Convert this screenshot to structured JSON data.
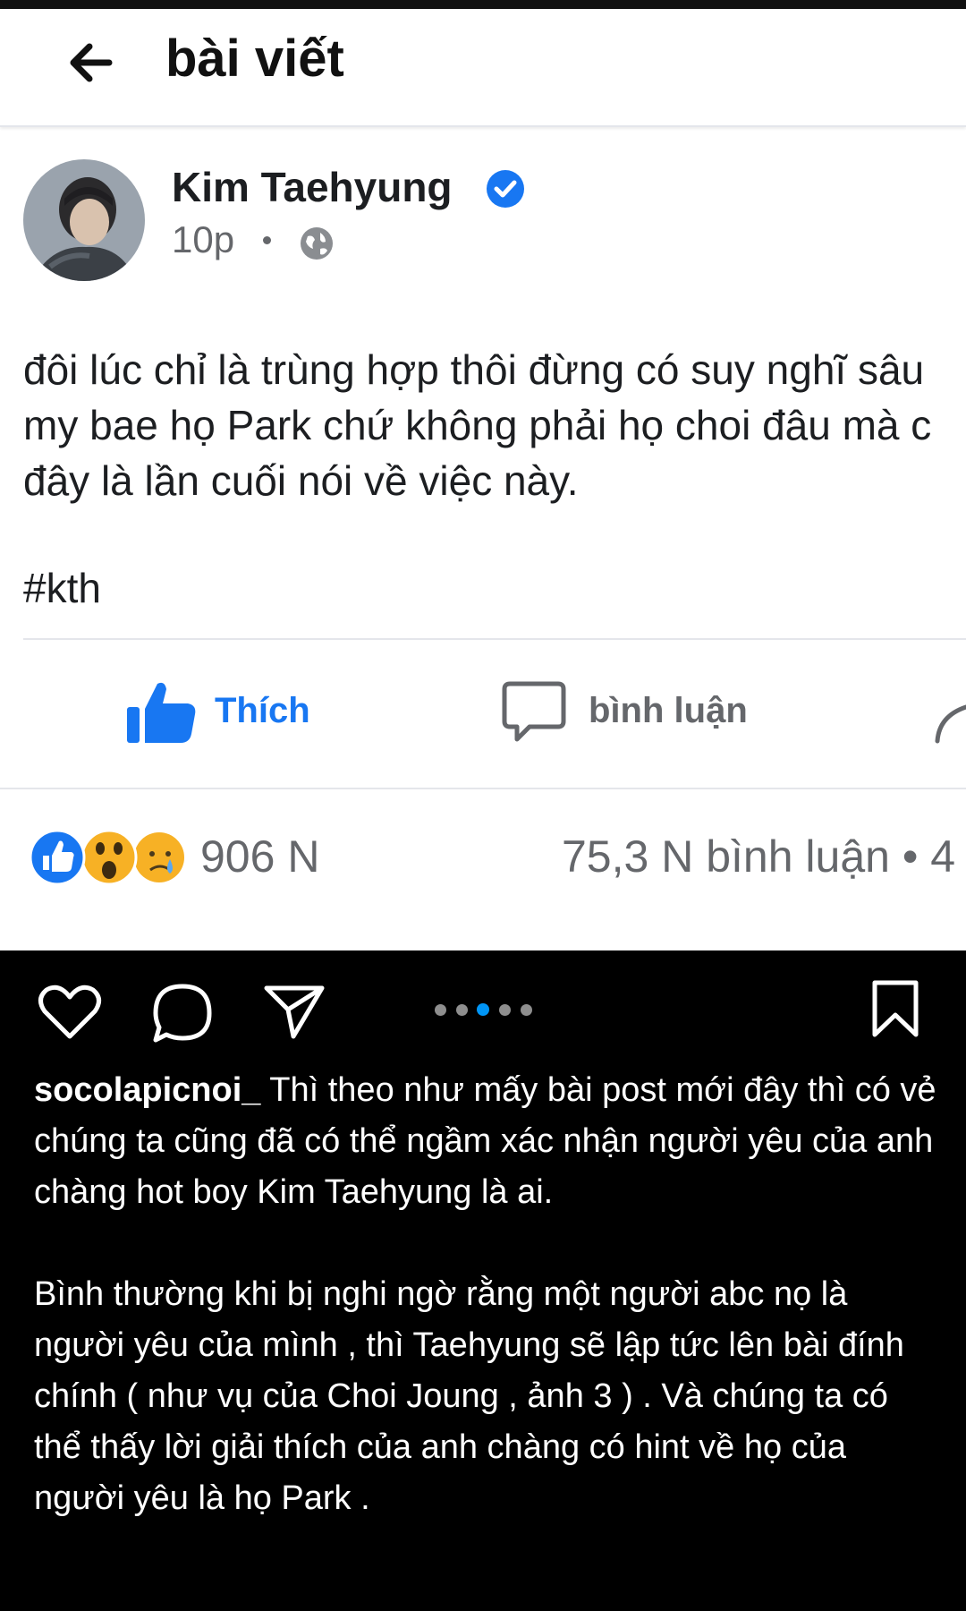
{
  "header": {
    "title": "bài viết",
    "back_icon": "arrow-left-icon"
  },
  "post": {
    "author": "Kim Taehyung",
    "verified_icon": "verified-badge-icon",
    "time": "10p",
    "privacy_icon": "globe-icon",
    "text_lines": [
      "đôi lúc chỉ là trùng hợp thôi đừng có suy nghĩ sâu",
      "my bae họ Park chứ không phải họ choi đâu mà c",
      "đây là lần cuối nói về việc này."
    ],
    "hashtag": "#kth"
  },
  "actions": {
    "like_label": "Thích",
    "comment_label": "bình luận",
    "like_color": "#1877f2"
  },
  "stats": {
    "reaction_count": "906 N",
    "comment_count": "75,3 N  bình luận • 4",
    "reaction_icons": [
      "like-reaction-icon",
      "wow-reaction-icon",
      "sad-reaction-icon"
    ]
  },
  "instagram": {
    "icons": [
      "heart-icon",
      "comment-icon",
      "send-icon",
      "bookmark-icon"
    ],
    "carousel_active_index": 2,
    "carousel_total": 5,
    "caption_user": "socolapicnoi_",
    "caption_first": "Thì theo như mấy bài post mới đây thì có vẻ chúng ta cũng đã có thể ngầm xác nhận người yêu của anh chàng hot boy Kim Taehyung là ai.",
    "caption_second": "Bình thường khi bị nghi ngờ rằng một người abc nọ là người yêu của mình , thì Taehyung sẽ lập tức lên bài đính chính ( như vụ của Choi Joung , ảnh 3 ) . Và chúng ta có thể thấy lời giải thích của anh chàng có hint về họ của người yêu là họ Park ."
  }
}
